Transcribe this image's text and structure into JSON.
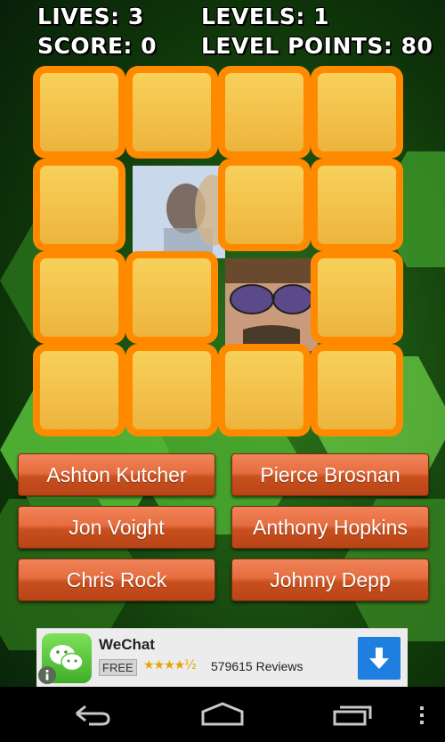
{
  "hud": {
    "lives": "LIVES: 3",
    "levels": "LEVELS: 1",
    "score": "SCORE: 0",
    "level_points": "LEVEL POINTS: 80"
  },
  "board": {
    "rows": 4,
    "cols": 4,
    "revealed_tiles": [
      "row2-col2",
      "row3-col3"
    ]
  },
  "answers": [
    {
      "label": "Ashton Kutcher"
    },
    {
      "label": "Pierce Brosnan"
    },
    {
      "label": "Jon Voight"
    },
    {
      "label": "Anthony Hopkins"
    },
    {
      "label": "Chris Rock"
    },
    {
      "label": "Johnny Depp"
    }
  ],
  "ad": {
    "app_name": "WeChat",
    "price": "FREE",
    "rating": "★★★★½",
    "reviews": "579615 Reviews",
    "icon": "wechat-icon"
  },
  "nav": {
    "back_icon": "back-icon",
    "home_icon": "home-icon",
    "recents_icon": "recents-icon",
    "menu_icon": "overflow-menu-icon"
  },
  "colors": {
    "tile_border": "#ff8a00",
    "tile_face": "#f3c14a",
    "answer_button": "#e66d3f",
    "background": "#1c5412"
  }
}
